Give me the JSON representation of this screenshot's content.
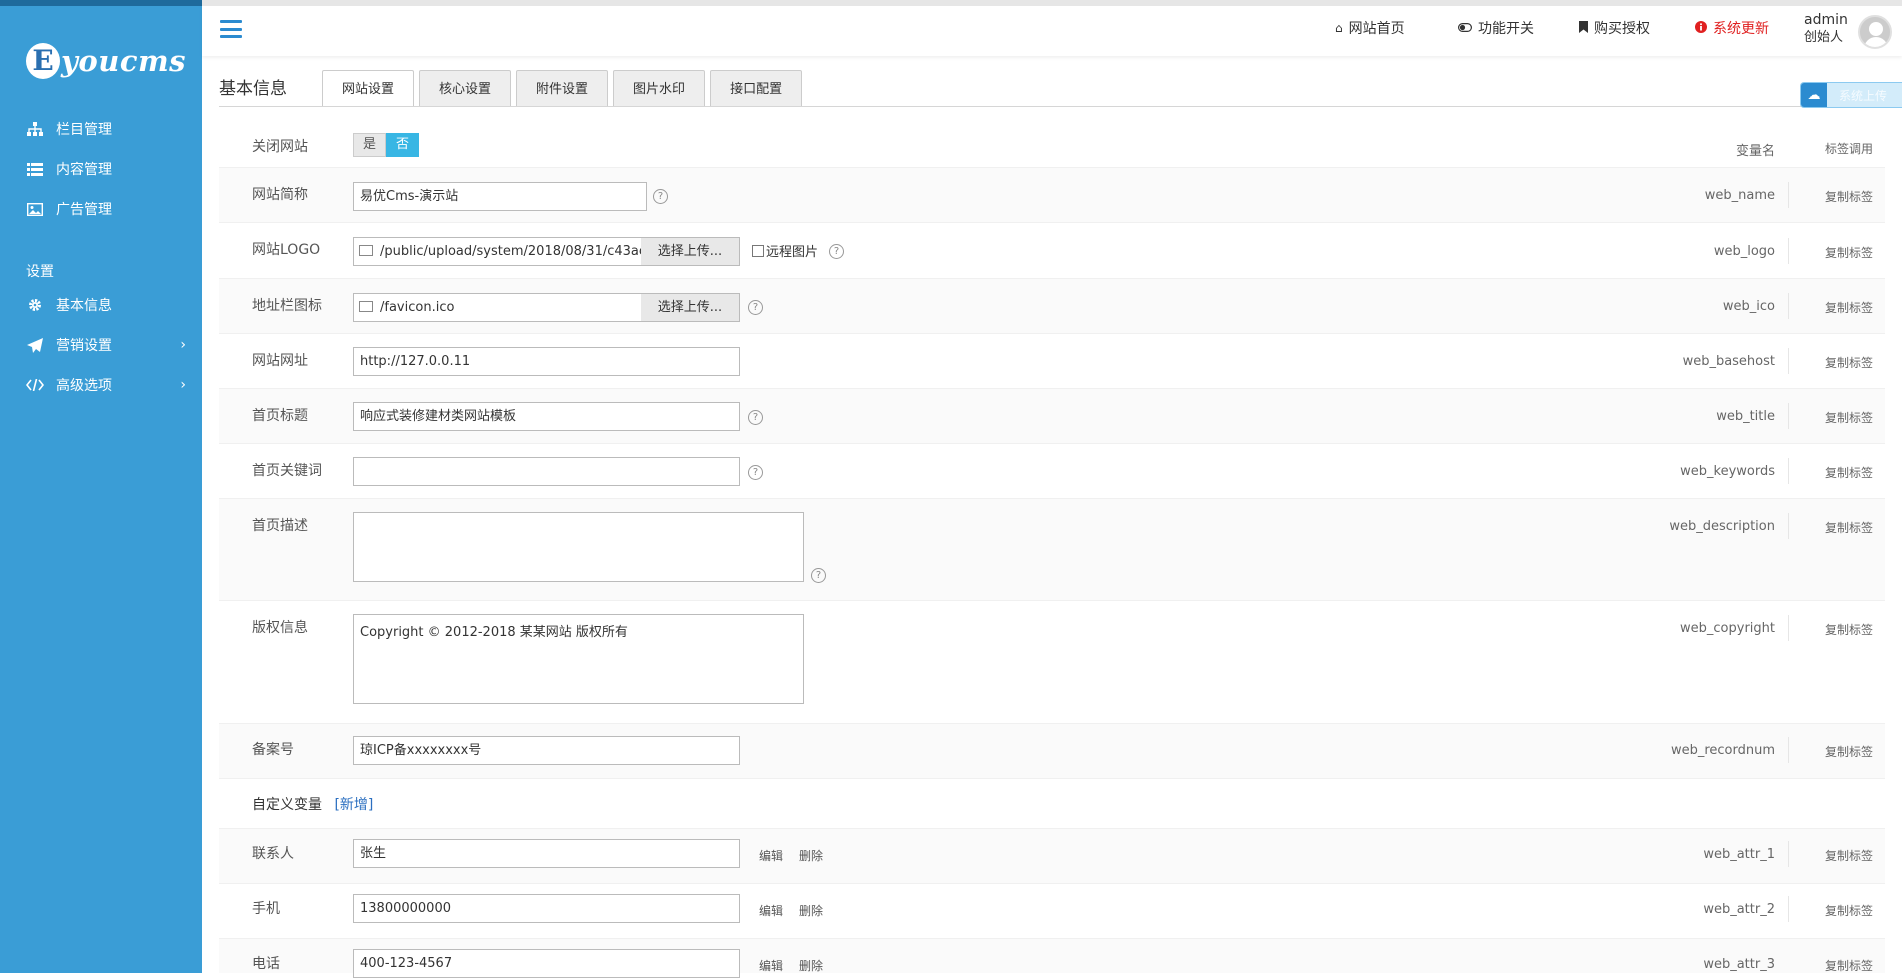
{
  "logo": {
    "e": "E",
    "text": "youcms"
  },
  "sidebar": {
    "items": [
      {
        "label": "栏目管理"
      },
      {
        "label": "内容管理"
      },
      {
        "label": "广告管理"
      }
    ],
    "section_title": "设置",
    "settings_items": [
      {
        "label": "基本信息"
      },
      {
        "label": "营销设置",
        "arrow": "›"
      },
      {
        "label": "高级选项",
        "arrow": "›"
      }
    ]
  },
  "topbar": {
    "links": [
      {
        "label": "网站首页",
        "icon": "home-icon"
      },
      {
        "label": "功能开关",
        "icon": "toggle-icon"
      },
      {
        "label": "购买授权",
        "icon": "bookmark-icon"
      },
      {
        "label": "系统更新",
        "icon": "info-icon",
        "color": "#e02020"
      }
    ],
    "user": {
      "name": "admin",
      "role": "创始人"
    }
  },
  "page": {
    "title": "基本信息",
    "tabs": [
      "网站设置",
      "核心设置",
      "附件设置",
      "图片水印",
      "接口配置"
    ],
    "active_tab": 0,
    "float_button": "系统上传"
  },
  "form": {
    "col_var": "变量名",
    "col_copy": "标签调用",
    "copy_label": "复制标签",
    "help": "?",
    "upload_label": "选择上传...",
    "remote_label": "远程图片",
    "close_site": {
      "label": "关闭网站",
      "yes": "是",
      "no": "否",
      "value": "否"
    },
    "web_name": {
      "label": "网站简称",
      "value": "易优Cms-演示站",
      "var": "web_name"
    },
    "web_logo": {
      "label": "网站LOGO",
      "value": "/public/upload/system/2018/08/31/c43ae",
      "var": "web_logo"
    },
    "web_ico": {
      "label": "地址栏图标",
      "value": "/favicon.ico",
      "var": "web_ico"
    },
    "web_basehost": {
      "label": "网站网址",
      "value": "http://127.0.0.11",
      "var": "web_basehost"
    },
    "web_title": {
      "label": "首页标题",
      "value": "响应式装修建材类网站模板",
      "var": "web_title"
    },
    "web_keywords": {
      "label": "首页关键词",
      "value": "",
      "var": "web_keywords"
    },
    "web_description": {
      "label": "首页描述",
      "value": "",
      "var": "web_description"
    },
    "web_copyright": {
      "label": "版权信息",
      "value": "Copyright © 2012-2018 某某网站 版权所有",
      "var": "web_copyright"
    },
    "web_recordnum": {
      "label": "备案号",
      "value": "琼ICP备xxxxxxxx号",
      "var": "web_recordnum"
    },
    "custom": {
      "label": "自定义变量",
      "add": "[新增]"
    },
    "edit_label": "编辑",
    "delete_label": "删除",
    "attrs": [
      {
        "label": "联系人",
        "value": "张生",
        "var": "web_attr_1"
      },
      {
        "label": "手机",
        "value": "13800000000",
        "var": "web_attr_2"
      },
      {
        "label": "电话",
        "value": "400-123-4567",
        "var": "web_attr_3"
      }
    ]
  }
}
